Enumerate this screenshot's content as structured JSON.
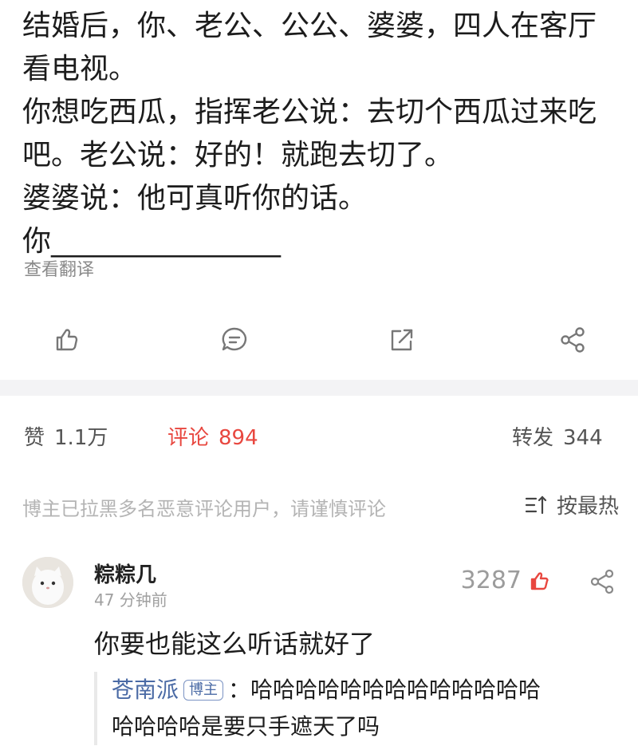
{
  "post": {
    "lines": [
      "结婚后，你、老公、公公、婆婆，四人在客厅",
      "看电视。",
      "你想吃西瓜，指挥老公说：去切个西瓜过来吃",
      "吧。老公说：好的！就跑去切了。",
      "婆婆说：他可真听你的话。",
      "你________________"
    ],
    "translate_label": "查看翻译"
  },
  "action_bar": {
    "icons": [
      "thumb-up-icon",
      "comment-icon",
      "repost-icon",
      "share-icon"
    ]
  },
  "stats": {
    "likes_label": "赞",
    "likes_count": "1.1万",
    "comments_label": "评论",
    "comments_count": "894",
    "reposts_label": "转发",
    "reposts_count": "344"
  },
  "comments_header": {
    "notice": "博主已拉黑多名恶意评论用户，请谨慎评论",
    "sort_label": "按最热"
  },
  "comment": {
    "username": "粽粽几",
    "time": "47 分钟前",
    "like_count": "3287",
    "text": "你要也能这么听话就好了",
    "reply": {
      "username": "苍南派",
      "badge": "博主",
      "separator": "：",
      "text_line1": "哈哈哈哈哈哈哈哈哈哈哈哈哈",
      "text_line2": "哈哈哈哈是要只手遮天了吗"
    }
  },
  "colors": {
    "accent_red": "#e8473f",
    "link_blue": "#4a6aa5",
    "muted_gray": "#a0a0a0"
  }
}
